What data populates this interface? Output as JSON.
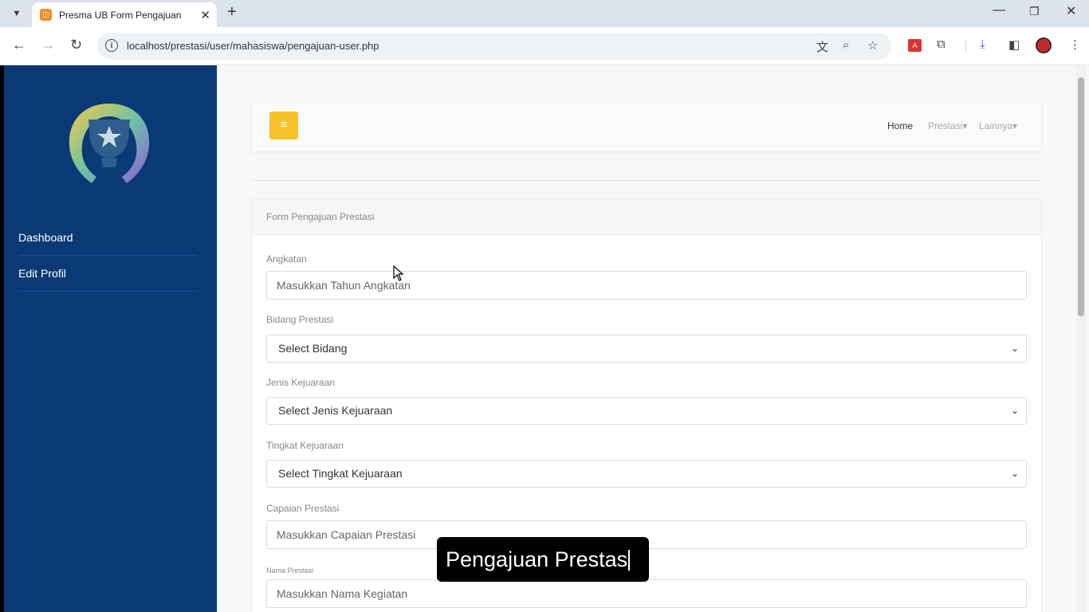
{
  "browser": {
    "tab_title": "Presma UB Form Pengajuan",
    "url": "localhost/prestasi/user/mahasiswa/pengajuan-user.php"
  },
  "sidebar": {
    "items": [
      {
        "label": "Dashboard"
      },
      {
        "label": "Edit Profil"
      }
    ]
  },
  "topnav": {
    "links": [
      {
        "label": "Home"
      },
      {
        "label": "Prestasi▾"
      },
      {
        "label": "Lainnya▾"
      }
    ]
  },
  "form": {
    "title": "Form Pengajuan Prestasi",
    "fields": [
      {
        "label": "Angkatan",
        "placeholder": "Masukkan Tahun Angkatan"
      },
      {
        "label": "Bidang Prestasi",
        "selected": "Select Bidang"
      },
      {
        "label": "Jenis Kejuaraan",
        "selected": "Select Jenis Kejuaraan"
      },
      {
        "label": "Tingkat Kejuaraan",
        "selected": "Select Tingkat Kejuaraan"
      },
      {
        "label": "Capaian Prestasi",
        "placeholder": "Masukkan Capaian Prestasi"
      },
      {
        "label": "Nama Prestasi",
        "placeholder": "Masukkan Nama Kegiatan"
      }
    ]
  },
  "caption": {
    "text": "Pengajuan Prestas"
  },
  "colors": {
    "sidebar": "#0a3a75",
    "menu_button": "#f7c12a"
  }
}
